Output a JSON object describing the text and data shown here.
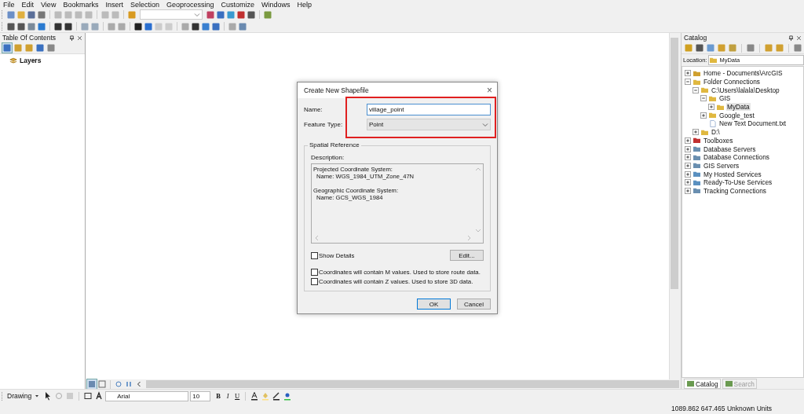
{
  "menu": [
    "File",
    "Edit",
    "View",
    "Bookmarks",
    "Insert",
    "Selection",
    "Geoprocessing",
    "Customize",
    "Windows",
    "Help"
  ],
  "toc": {
    "title": "Table Of Contents",
    "layers": "Layers"
  },
  "dialog": {
    "title": "Create New Shapefile",
    "close": "×",
    "name_label": "Name:",
    "name_value": "village_point",
    "type_label": "Feature Type:",
    "type_value": "Point",
    "group": "Spatial Reference",
    "description_label": "Description:",
    "description": [
      {
        "heading": "Projected Coordinate System:",
        "name": "Name: WGS_1984_UTM_Zone_47N"
      },
      {
        "heading": "Geographic Coordinate System:",
        "name": "Name: GCS_WGS_1984"
      }
    ],
    "options": [
      {
        "label": "Show Details",
        "checked": false
      },
      {
        "label": "Coordinates will contain M values. Used to store route data.",
        "checked": false
      },
      {
        "label": "Coordinates will contain Z values. Used to store 3D data.",
        "checked": false
      }
    ],
    "edit_button": "Edit...",
    "ok": "OK",
    "cancel": "Cancel"
  },
  "catalog": {
    "title": "Catalog",
    "location_label": "Location:",
    "location": "MyData",
    "tree": [
      {
        "label": "Home - Documents\\ArcGIS",
        "kind": "home",
        "expanded": false,
        "selected": false
      },
      {
        "label": "Folder Connections",
        "kind": "folder",
        "expanded": true,
        "selected": false,
        "children": [
          {
            "label": "C:\\Users\\lalala\\Desktop",
            "kind": "folder",
            "expanded": true,
            "selected": false,
            "children": [
              {
                "label": "GIS",
                "kind": "folder",
                "expanded": true,
                "selected": false,
                "children": [
                  {
                    "label": "MyData",
                    "kind": "folder",
                    "expanded": false,
                    "selected": true
                  }
                ]
              },
              {
                "label": "Google_test",
                "kind": "folder",
                "expanded": false,
                "selected": false
              },
              {
                "label": "New Text Document.txt",
                "kind": "file",
                "selected": false
              }
            ]
          },
          {
            "label": "D:\\",
            "kind": "folder",
            "expanded": false,
            "selected": false
          }
        ]
      },
      {
        "label": "Toolboxes",
        "kind": "toolbox",
        "expanded": false,
        "selected": false
      },
      {
        "label": "Database Servers",
        "kind": "server",
        "expanded": false,
        "selected": false
      },
      {
        "label": "Database Connections",
        "kind": "server",
        "expanded": false,
        "selected": false
      },
      {
        "label": "GIS Servers",
        "kind": "server",
        "expanded": false,
        "selected": false
      },
      {
        "label": "My Hosted Services",
        "kind": "cloud",
        "expanded": false,
        "selected": false
      },
      {
        "label": "Ready-To-Use Services",
        "kind": "cloud",
        "expanded": false,
        "selected": false
      },
      {
        "label": "Tracking Connections",
        "kind": "server",
        "expanded": false,
        "selected": false
      }
    ],
    "tabs": [
      {
        "label": "Catalog",
        "selected": true
      },
      {
        "label": "Search",
        "selected": false
      }
    ]
  },
  "drawing": {
    "menu": "Drawing",
    "font": "Arial",
    "size": "10",
    "text_buttons": [
      "B",
      "I",
      "U"
    ]
  },
  "status": "1089.862  647.465 Unknown Units"
}
